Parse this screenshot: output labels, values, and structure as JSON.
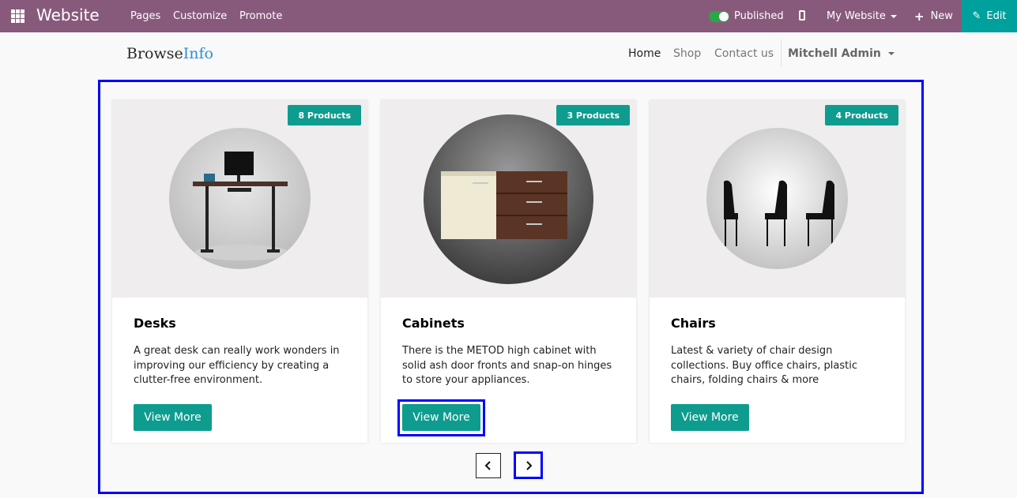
{
  "topbar": {
    "brand": "Website",
    "menu": [
      "Pages",
      "Customize",
      "Promote"
    ],
    "published_label": "Published",
    "website_selector": "My Website",
    "new_label": "New",
    "edit_label": "Edit",
    "colors": {
      "bar": "#875a7b",
      "edit": "#00a09d",
      "toggle_on": "#28a745"
    }
  },
  "site": {
    "logo_part1": "Browse",
    "logo_part2": "Info",
    "nav": [
      "Home",
      "Shop",
      "Contact us"
    ],
    "user": "Mitchell Admin"
  },
  "cards": [
    {
      "title": "Desks",
      "badge": "8 Products",
      "description": "A great desk can really work wonders in improving our efficiency by creating a clutter-free environment.",
      "button": "View More",
      "image": "desk-image"
    },
    {
      "title": "Cabinets",
      "badge": "3 Products",
      "description": "There is the METOD high cabinet with solid ash door fronts and snap-on hinges to store your appliances.",
      "button": "View More",
      "image": "cabinet-image"
    },
    {
      "title": "Chairs",
      "badge": "4 Products",
      "description": "Latest & variety of chair design collections. Buy office chairs, plastic chairs, folding chairs & more",
      "button": "View More",
      "image": "chairs-image"
    }
  ],
  "carousel": {
    "prev_icon": "chevron-left-icon",
    "next_icon": "chevron-right-icon"
  },
  "accent": "#0e9c8f"
}
